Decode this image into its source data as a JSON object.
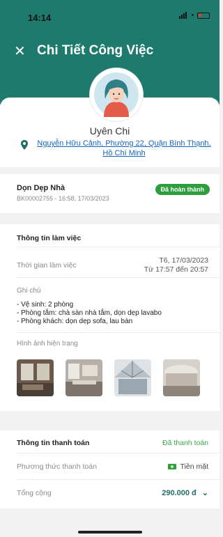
{
  "status": {
    "time": "14:14"
  },
  "header": {
    "title": "Chi Tiết Công Việc"
  },
  "user": {
    "name": "Uyên Chi",
    "address": "Nguyễn Hữu Cảnh, Phường 22, Quận Bình Thạnh, Hồ Chí Minh"
  },
  "service": {
    "name": "Dọn Dẹp Nhà",
    "code": "BK00002755 - 16:58, 17/03/2023",
    "status": "Đã hoàn thành"
  },
  "work": {
    "title": "Thông tin làm việc",
    "time_label": "Thời gian làm việc",
    "time_date": "T6, 17/03/2023",
    "time_range": "Từ 17:57 đến 20:57",
    "note_label": "Ghi chú",
    "notes": [
      "- Vệ sinh: 2 phòng",
      "- Phòng tắm: chà sàn nhà tắm, dọn dẹp lavabo",
      "- Phòng khách: dọn dẹp sofa, lau bàn"
    ],
    "photos_label": "Hình ảnh hiện trạng"
  },
  "payment": {
    "title": "Thông tin thanh toán",
    "status": "Đã thanh toán",
    "method_label": "Phương thức thanh toán",
    "method": "Tiền mặt",
    "total_label": "Tổng cộng",
    "total": "290.000 đ"
  },
  "colors": {
    "primary": "#1f7a6e",
    "success": "#2e9e3d",
    "link": "#1565c0"
  }
}
